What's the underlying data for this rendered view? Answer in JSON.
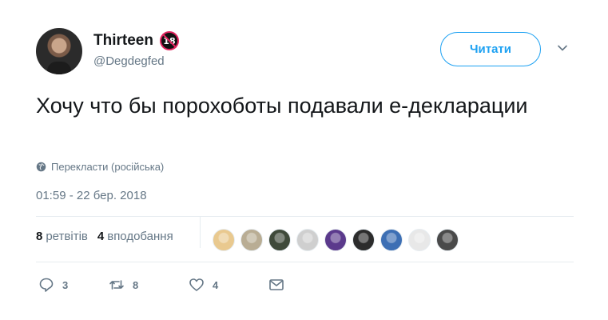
{
  "tweet": {
    "author": {
      "display_name": "Thirteen",
      "badge": "18",
      "handle": "@Degdegfed"
    },
    "follow_label": "Читати",
    "text": "Хочу что бы порохоботы подавали е-декларации",
    "translate_label": "Перекласти (російська)",
    "timestamp": "01:59 - 22 бер. 2018"
  },
  "stats": {
    "retweets_count": "8",
    "retweets_label": "ретвітів",
    "likes_count": "4",
    "likes_label": "вподобання"
  },
  "likers": [
    {
      "name": "liker-avatar",
      "color": "#e9c98f"
    },
    {
      "name": "liker-avatar",
      "color": "#b9ad94"
    },
    {
      "name": "liker-avatar",
      "color": "#3f4a3a"
    },
    {
      "name": "liker-avatar",
      "color": "#cfcfcf"
    },
    {
      "name": "liker-avatar",
      "color": "#5b3a8c"
    },
    {
      "name": "liker-avatar",
      "color": "#2c2c2c"
    },
    {
      "name": "liker-avatar",
      "color": "#3d6fb4"
    },
    {
      "name": "liker-avatar",
      "color": "#e8e8e8"
    },
    {
      "name": "liker-avatar",
      "color": "#4a4a4a"
    }
  ],
  "actions": {
    "reply_count": "3",
    "retweet_count": "8",
    "like_count": "4"
  },
  "colors": {
    "accent": "#1da1f2",
    "muted": "#657786",
    "text": "#14171a"
  },
  "icons": [
    "chevron-down-icon",
    "globe-icon",
    "reply-icon",
    "retweet-icon",
    "heart-icon",
    "envelope-icon",
    "age-18-badge-icon"
  ]
}
